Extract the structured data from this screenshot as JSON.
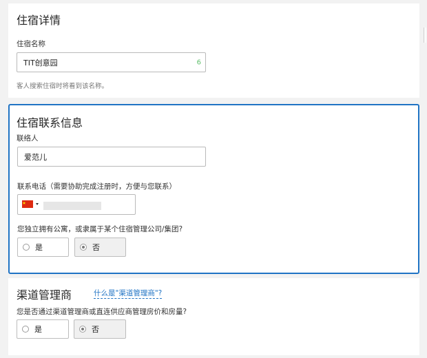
{
  "basic": {
    "title": "住宿详情",
    "name_label": "住宿名称",
    "name_value": "TIT创意园",
    "name_count": "6",
    "name_hint": "客人搜索住宿时将看到该名称。"
  },
  "contact": {
    "title": "住宿联系信息",
    "person_label": "联络人",
    "person_value": "爱范儿",
    "phone_label": "联系电话（需要协助完成注册时，方便与您联系）",
    "phone_flag": "cn-flag-icon",
    "phone_value": "",
    "ownership_question": "您独立拥有公寓，或隶属于某个住宿管理公司/集团?",
    "ownership_options": [
      {
        "label": "是",
        "selected": false
      },
      {
        "label": "否",
        "selected": true
      }
    ]
  },
  "channel": {
    "title": "渠道管理商",
    "help_link": "什么是\"渠道管理商\"?",
    "question": "您是否通过渠道管理商或直连供应商管理房价和房量?",
    "options": [
      {
        "label": "是",
        "selected": false
      },
      {
        "label": "否",
        "selected": true
      }
    ]
  },
  "colors": {
    "accent": "#1f73c4",
    "count_green": "#5fbf6b",
    "page_bg": "#f2f2f2"
  }
}
